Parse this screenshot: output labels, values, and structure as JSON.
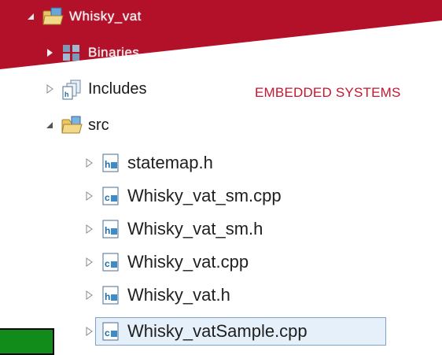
{
  "tree": {
    "project_label": "Whisky_vat",
    "binaries_label": "Binaries",
    "includes_label": "Includes",
    "src_label": "src",
    "files": [
      {
        "label": "statemap.h",
        "type": "h"
      },
      {
        "label": "Whisky_vat_sm.cpp",
        "type": "cpp"
      },
      {
        "label": "Whisky_vat_sm.h",
        "type": "h"
      },
      {
        "label": "Whisky_vat.cpp",
        "type": "cpp"
      },
      {
        "label": "Whisky_vat.h",
        "type": "h"
      },
      {
        "label": "Whisky_vatSample.cpp",
        "type": "cpp",
        "selected": true
      }
    ]
  },
  "banner": {
    "caption": "EMBEDDED SYSTEMS",
    "color": "#b3112a"
  },
  "icons": {
    "project": "project-folder-icon",
    "binaries": "binaries-icon",
    "includes": "includes-icon",
    "src": "source-folder-icon",
    "h_file": "header-file-icon",
    "cpp_file": "cpp-file-icon"
  }
}
